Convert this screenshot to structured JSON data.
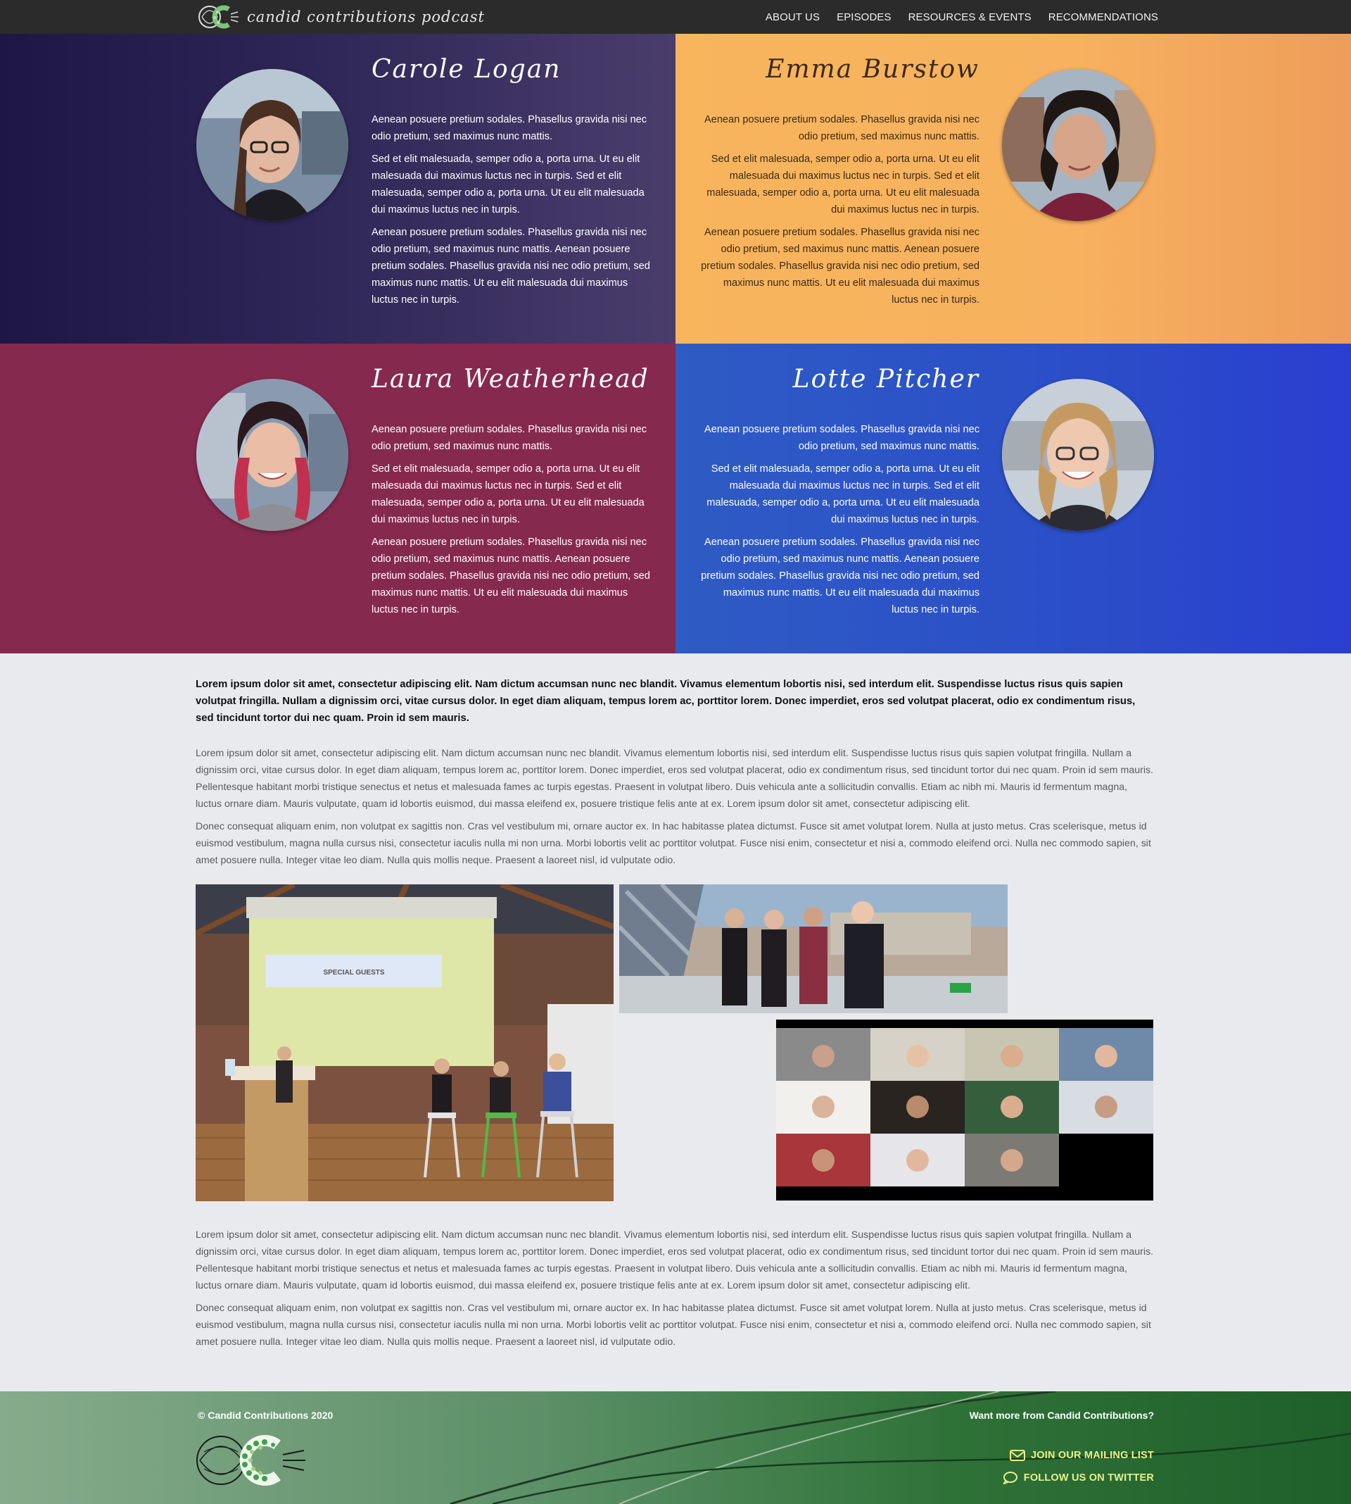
{
  "header": {
    "brand": "candid contributions podcast",
    "nav": [
      "ABOUT US",
      "EPISODES",
      "RESOURCES & EVENTS",
      "RECOMMENDATIONS"
    ]
  },
  "people": [
    {
      "name": "Carole Logan",
      "bio": [
        "Aenean posuere pretium sodales. Phasellus gravida nisi nec odio pretium, sed maximus nunc mattis.",
        "Sed et elit malesuada, semper odio a, porta urna. Ut eu elit malesuada dui maximus luctus nec in turpis. Sed et elit malesuada, semper odio a, porta urna. Ut eu elit malesuada dui maximus luctus nec in turpis.",
        "Aenean posuere pretium sodales. Phasellus gravida nisi nec odio pretium, sed maximus nunc mattis. Aenean posuere pretium sodales. Phasellus gravida nisi nec odio pretium, sed maximus nunc mattis. Ut eu elit malesuada dui maximus luctus nec in turpis."
      ]
    },
    {
      "name": "Emma Burstow",
      "bio": [
        "Aenean posuere pretium sodales. Phasellus gravida nisi nec odio pretium, sed maximus nunc mattis.",
        "Sed et elit malesuada, semper odio a, porta urna. Ut eu elit malesuada dui maximus luctus nec in turpis. Sed et elit malesuada, semper odio a, porta urna. Ut eu elit malesuada dui maximus luctus nec in turpis.",
        "Aenean posuere pretium sodales. Phasellus gravida nisi nec odio pretium, sed maximus nunc mattis. Aenean posuere pretium sodales. Phasellus gravida nisi nec odio pretium, sed maximus nunc mattis. Ut eu elit malesuada dui maximus luctus nec in turpis."
      ]
    },
    {
      "name": "Laura Weatherhead",
      "bio": [
        "Aenean posuere pretium sodales. Phasellus gravida nisi nec odio pretium, sed maximus nunc mattis.",
        "Sed et elit malesuada, semper odio a, porta urna. Ut eu elit malesuada dui maximus luctus nec in turpis. Sed et elit malesuada, semper odio a, porta urna. Ut eu elit malesuada dui maximus luctus nec in turpis.",
        "Aenean posuere pretium sodales. Phasellus gravida nisi nec odio pretium, sed maximus nunc mattis. Aenean posuere pretium sodales. Phasellus gravida nisi nec odio pretium, sed maximus nunc mattis. Ut eu elit malesuada dui maximus luctus nec in turpis."
      ]
    },
    {
      "name": "Lotte Pitcher",
      "bio": [
        "Aenean posuere pretium sodales. Phasellus gravida nisi nec odio pretium, sed maximus nunc mattis.",
        "Sed et elit malesuada, semper odio a, porta urna. Ut eu elit malesuada dui maximus luctus nec in turpis. Sed et elit malesuada, semper odio a, porta urna. Ut eu elit malesuada dui maximus luctus nec in turpis.",
        "Aenean posuere pretium sodales. Phasellus gravida nisi nec odio pretium, sed maximus nunc mattis. Aenean posuere pretium sodales. Phasellus gravida nisi nec odio pretium, sed maximus nunc mattis. Ut eu elit malesuada dui maximus luctus nec in turpis."
      ]
    }
  ],
  "main": {
    "lead": "Lorem ipsum dolor sit amet, consectetur adipiscing elit. Nam dictum accumsan nunc nec blandit. Vivamus elementum lobortis nisi, sed interdum elit. Suspendisse luctus risus quis sapien volutpat fringilla. Nullam a dignissim orci, vitae cursus dolor. In eget diam aliquam, tempus lorem ac, porttitor lorem. Donec imperdiet, eros sed volutpat placerat, odio ex condimentum risus, sed tincidunt tortor dui nec quam. Proin id sem mauris.",
    "para1": "Lorem ipsum dolor sit amet, consectetur adipiscing elit. Nam dictum accumsan nunc nec blandit. Vivamus elementum lobortis nisi, sed interdum elit. Suspendisse luctus risus quis sapien volutpat fringilla. Nullam a dignissim orci, vitae cursus dolor. In eget diam aliquam, tempus lorem ac, porttitor lorem. Donec imperdiet, eros sed volutpat placerat, odio ex condimentum risus, sed tincidunt tortor dui nec quam. Proin id sem mauris. Pellentesque habitant morbi tristique senectus et netus et malesuada fames ac turpis egestas. Praesent in volutpat libero. Duis vehicula ante a sollicitudin convallis. Etiam ac nibh mi. Mauris id fermentum magna, luctus ornare diam. Mauris vulputate, quam id lobortis euismod, dui massa eleifend ex, posuere tristique felis ante at ex. Lorem ipsum dolor sit amet, consectetur adipiscing elit.",
    "para2": "Donec consequat aliquam enim, non volutpat ex sagittis non. Cras vel vestibulum mi, ornare auctor ex. In hac habitasse platea dictumst. Fusce sit amet volutpat lorem. Nulla at justo metus. Cras scelerisque, metus id euismod vestibulum, magna nulla cursus nisi, consectetur iaculis nulla mi non urna. Morbi lobortis velit ac porttitor volutpat. Fusce nisi enim, consectetur et nisi a, commodo eleifend orci. Nulla nec commodo sapien, sit amet posuere nulla. Integer vitae leo diam. Nulla quis mollis neque. Praesent a laoreet nisl, id vulputate odio.",
    "slide_text": "SPECIAL GUESTS",
    "para3": "Lorem ipsum dolor sit amet, consectetur adipiscing elit. Nam dictum accumsan nunc nec blandit. Vivamus elementum lobortis nisi, sed interdum elit. Suspendisse luctus risus quis sapien volutpat fringilla. Nullam a dignissim orci, vitae cursus dolor. In eget diam aliquam, tempus lorem ac, porttitor lorem. Donec imperdiet, eros sed volutpat placerat, odio ex condimentum risus, sed tincidunt tortor dui nec quam. Proin id sem mauris. Pellentesque habitant morbi tristique senectus et netus et malesuada fames ac turpis egestas. Praesent in volutpat libero. Duis vehicula ante a sollicitudin convallis. Etiam ac nibh mi. Mauris id fermentum magna, luctus ornare diam. Mauris vulputate, quam id lobortis euismod, dui massa eleifend ex, posuere tristique felis ante at ex. Lorem ipsum dolor sit amet, consectetur adipiscing elit.",
    "para4": "Donec consequat aliquam enim, non volutpat ex sagittis non. Cras vel vestibulum mi, ornare auctor ex. In hac habitasse platea dictumst. Fusce sit amet volutpat lorem. Nulla at justo metus. Cras scelerisque, metus id euismod vestibulum, magna nulla cursus nisi, consectetur iaculis nulla mi non urna. Morbi lobortis velit ac porttitor volutpat. Fusce nisi enim, consectetur et nisi a, commodo eleifend orci. Nulla nec commodo sapien, sit amet posuere nulla. Integer vitae leo diam. Nulla quis mollis neque. Praesent a laoreet nisl, id vulputate odio."
  },
  "footer": {
    "copyright": "© Candid Contributions 2020",
    "more_heading": "Want more from Candid Contributions?",
    "mailing_label": "JOIN OUR MAILING LIST",
    "twitter_label": "FOLLOW US ON TWITTER",
    "link_color": "#e9ef8a",
    "icons": [
      "envelope-icon",
      "speech-bubble-icon"
    ]
  }
}
